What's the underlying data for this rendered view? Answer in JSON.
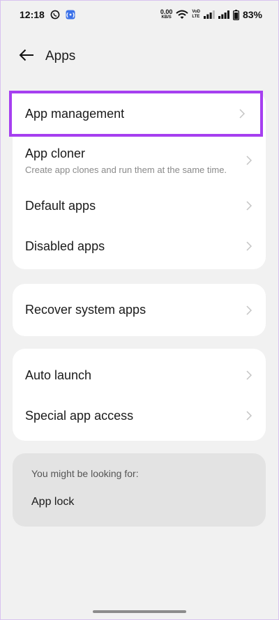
{
  "status_bar": {
    "time": "12:18",
    "net_speed_value": "0.00",
    "net_speed_unit": "KB/S",
    "volte_top": "VoD",
    "volte_bottom": "LTE",
    "battery_percent": "83%",
    "icons": [
      "whatsapp-icon",
      "app-notification-icon",
      "wifi-icon",
      "signal-icon",
      "signal-icon",
      "battery-icon"
    ]
  },
  "header": {
    "title": "Apps",
    "back_icon": "arrow-left-icon"
  },
  "groups": [
    {
      "items": [
        {
          "label": "App management",
          "subtitle": ""
        },
        {
          "label": "App cloner",
          "subtitle": "Create app clones and run them at the same time."
        },
        {
          "label": "Default apps",
          "subtitle": ""
        },
        {
          "label": "Disabled apps",
          "subtitle": ""
        }
      ]
    },
    {
      "items": [
        {
          "label": "Recover system apps",
          "subtitle": ""
        }
      ]
    },
    {
      "items": [
        {
          "label": "Auto launch",
          "subtitle": ""
        },
        {
          "label": "Special app access",
          "subtitle": ""
        }
      ]
    }
  ],
  "suggestions": {
    "title": "You might be looking for:",
    "items": [
      "App lock"
    ]
  },
  "colors": {
    "highlight": "#a63ff0",
    "background": "#f1f1f1",
    "card": "#ffffff",
    "suggest_card": "#e3e3e3"
  }
}
